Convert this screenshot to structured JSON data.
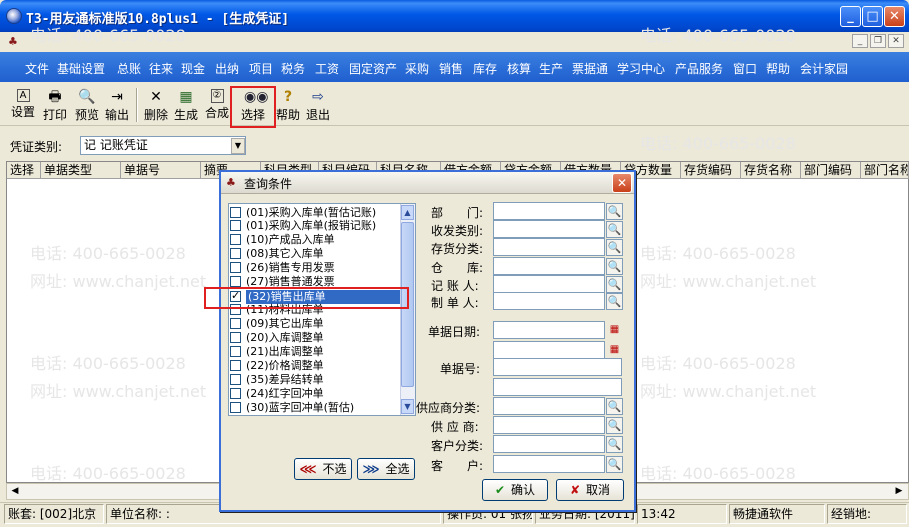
{
  "window": {
    "title": "T3-用友通标准版10.8plus1 - [生成凭证]",
    "app_icon": "app-logo-icon"
  },
  "menu": [
    "文件",
    "基础设置",
    "总账",
    "往来",
    "现金",
    "出纳",
    "项目",
    "税务",
    "工资",
    "固定资产",
    "采购",
    "销售",
    "库存",
    "核算",
    "生产",
    "票据通",
    "学习中心",
    "产品服务",
    "窗口",
    "帮助",
    "会计家园"
  ],
  "toolbar": [
    {
      "label": "设置",
      "icon": "settings-icon"
    },
    {
      "label": "打印",
      "icon": "printer-icon"
    },
    {
      "label": "预览",
      "icon": "preview-icon"
    },
    {
      "label": "输出",
      "icon": "export-icon"
    },
    {
      "label": "删除",
      "icon": "delete-icon"
    },
    {
      "label": "生成",
      "icon": "generate-icon"
    },
    {
      "label": "合成",
      "icon": "merge-icon"
    },
    {
      "label": "选择",
      "icon": "binoculars-icon"
    },
    {
      "label": "帮助",
      "icon": "help-icon"
    },
    {
      "label": "退出",
      "icon": "exit-icon"
    }
  ],
  "voucher_type": {
    "label": "凭证类别:",
    "value": "记 记账凭证"
  },
  "grid": {
    "columns": [
      "选择",
      "单据类型",
      "单据号",
      "摘要",
      "科目类型",
      "科目编码",
      "科目名称",
      "借方金额",
      "贷方金额",
      "借方数量",
      "贷方数量",
      "存货编码",
      "存货名称",
      "部门编码",
      "部门名称"
    ]
  },
  "watermark": {
    "phone": "电话: 400-665-0028",
    "site": "网址: www.chanjet.net"
  },
  "status": {
    "account": "账套: [002]北京",
    "unit": "单位名称: :",
    "operator": "操作员: 01 张扬",
    "biz_date": "业务日期: [2011]",
    "time": "13:42",
    "company": "畅捷通软件",
    "address": "经销地:"
  },
  "dialog": {
    "title": "查询条件",
    "list_items": [
      {
        "label": "(01)采购入库单(暂估记账)",
        "checked": false
      },
      {
        "label": "(01)采购入库单(报销记账)",
        "checked": false
      },
      {
        "label": "(10)产成品入库单",
        "checked": false
      },
      {
        "label": "(08)其它入库单",
        "checked": false
      },
      {
        "label": "(26)销售专用发票",
        "checked": false
      },
      {
        "label": "(27)销售普通发票",
        "checked": false
      },
      {
        "label": "(32)销售出库单",
        "checked": true
      },
      {
        "label": "(11)材料出库单",
        "checked": false
      },
      {
        "label": "(09)其它出库单",
        "checked": false
      },
      {
        "label": "(20)入库调整单",
        "checked": false
      },
      {
        "label": "(21)出库调整单",
        "checked": false
      },
      {
        "label": "(22)价格调整单",
        "checked": false
      },
      {
        "label": "(35)差异结转单",
        "checked": false
      },
      {
        "label": "(24)红字回冲单",
        "checked": false
      },
      {
        "label": "(30)蓝字回冲单(暂估)",
        "checked": false
      }
    ],
    "fields": {
      "dept": "部　　门:",
      "recv_type": "收发类别:",
      "inv_class": "存货分类:",
      "warehouse": "仓　　库:",
      "bookkeeper": "记 账 人:",
      "maker": "制 单 人:",
      "doc_date": "单据日期:",
      "doc_no": "单据号:",
      "vendor_class": "供应商分类:",
      "vendor": "供 应 商:",
      "cust_class": "客户分类:",
      "customer": "客　　户:"
    },
    "buttons": {
      "unselect": "不选",
      "select_all": "全选",
      "ok": "确认",
      "cancel": "取消"
    }
  }
}
